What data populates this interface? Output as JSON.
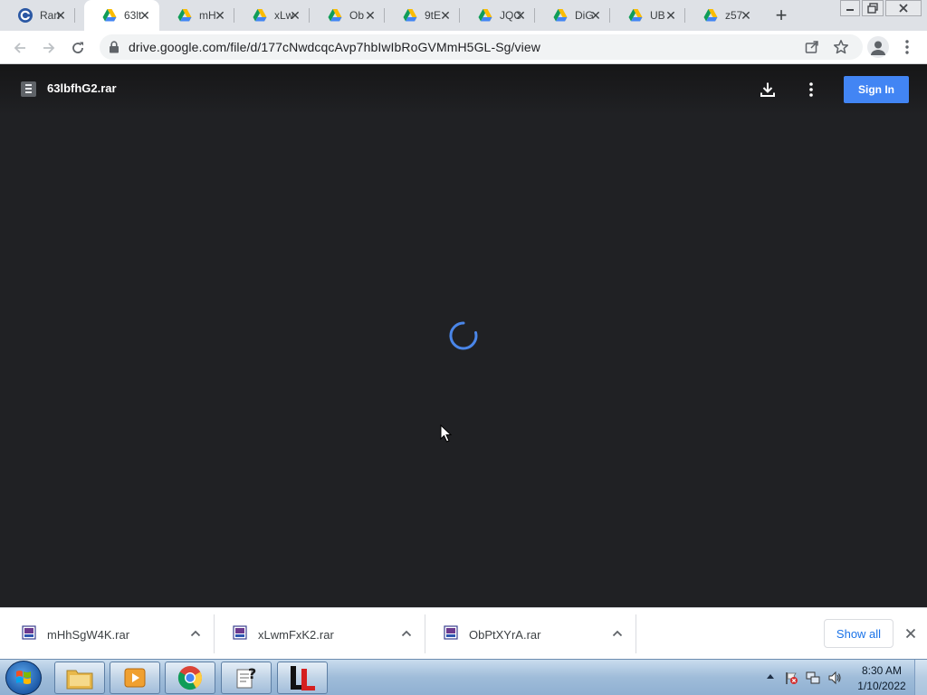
{
  "browser": {
    "tabs": [
      {
        "title": "Ran",
        "favicon": "chrome-c-icon",
        "active": false
      },
      {
        "title": "63lt",
        "favicon": "google-drive-icon",
        "active": true
      },
      {
        "title": "mH",
        "favicon": "google-drive-icon",
        "active": false
      },
      {
        "title": "xLw",
        "favicon": "google-drive-icon",
        "active": false
      },
      {
        "title": "Ob",
        "favicon": "google-drive-icon",
        "active": false
      },
      {
        "title": "9tE",
        "favicon": "google-drive-icon",
        "active": false
      },
      {
        "title": "JQC",
        "favicon": "google-drive-icon",
        "active": false
      },
      {
        "title": "DiG",
        "favicon": "google-drive-icon",
        "active": false
      },
      {
        "title": "UB",
        "favicon": "google-drive-icon",
        "active": false
      },
      {
        "title": "z57",
        "favicon": "google-drive-icon",
        "active": false
      }
    ],
    "tab_close_glyph": "✕",
    "new_tab_glyph": "+",
    "url": "drive.google.com/file/d/177cNwdcqcAvp7hbIwIbRoGVMmH5GL-Sg/view"
  },
  "viewer": {
    "file_name": "63lbfhG2.rar",
    "sign_in_label": "Sign In",
    "spinner_color": "#4a86e8"
  },
  "downloads": {
    "items": [
      {
        "name": "mHhSgW4K.rar"
      },
      {
        "name": "xLwmFxK2.rar"
      },
      {
        "name": "ObPtXYrA.rar"
      }
    ],
    "show_all_label": "Show all"
  },
  "taskbar": {
    "apps": [
      "windows-explorer-icon",
      "media-player-icon",
      "chrome-icon",
      "help-document-icon",
      "ll-app-icon"
    ],
    "clock_time": "8:30 AM",
    "clock_date": "1/10/2022"
  },
  "colors": {
    "accent": "#4285f4",
    "viewer_bg": "#202124",
    "tabstrip_bg": "#dee1e6"
  }
}
